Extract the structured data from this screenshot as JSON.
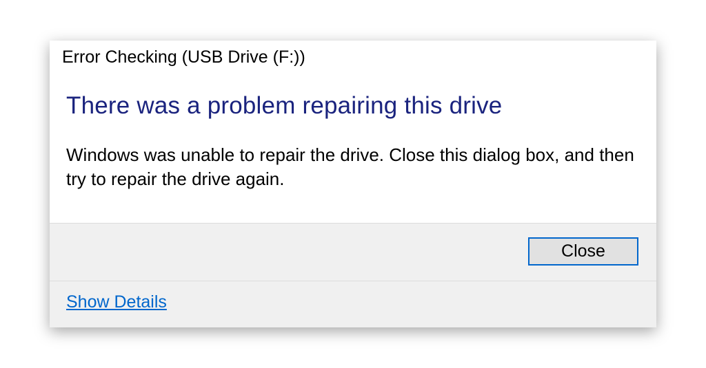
{
  "dialog": {
    "title": "Error Checking (USB Drive (F:))",
    "heading": "There was a problem repairing this drive",
    "message": "Windows was unable to repair the drive. Close this dialog box, and then try to repair the drive again.",
    "close_label": "Close",
    "show_details_label": "Show Details"
  }
}
